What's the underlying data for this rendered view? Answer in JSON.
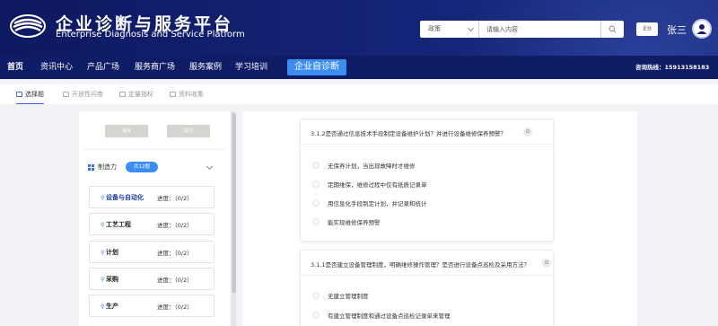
{
  "header": {
    "title": "企业诊断与服务平台",
    "subtitle": "Enterprise Diagnosis and Service Platform",
    "search_select_value": "政策",
    "search_placeholder": "请输入内容",
    "corp_button": "企业",
    "user_name": "张三",
    "brand_color": "#142476"
  },
  "nav": {
    "items": [
      "首页",
      "资讯中心",
      "产品广场",
      "服务商广场",
      "服务案例",
      "学习培训",
      "企业自诊断"
    ],
    "hotline": "咨询热线：15913158183",
    "active_color": "#3d8df0"
  },
  "tabs": [
    "选择题",
    "开放性问卷",
    "定量指标",
    "资料收集"
  ],
  "left": {
    "buttons": [
      "保存",
      "提交"
    ],
    "category": {
      "label": "制造力",
      "badge": "共12题"
    },
    "items": [
      {
        "name": "设备与自动化",
        "progress": "进度：（0/2）"
      },
      {
        "name": "工艺工程",
        "progress": "进度：（0/2）"
      },
      {
        "name": "计划",
        "progress": "进度：（0/2）"
      },
      {
        "name": "采购",
        "progress": "进度：（0/2）"
      },
      {
        "name": "生产",
        "progress": "进度：（0/2）"
      }
    ]
  },
  "questions": [
    {
      "title": "3.1.2是否通过信息技术手段制定设备维护计划？并进行设备维修保养预警？",
      "options": [
        "无保养计划，当出现故障时才维修",
        "定期维保，维修过程中仅有纸质记录单",
        "用信息化手段制定计划，并记录和统计",
        "能实现维修保养预警"
      ]
    },
    {
      "title": "3.1.1是否建立设备管理制度，明确维修操作管理？是否进行设备点巡检及采用方法？",
      "options": [
        "无建立管理制度",
        "有建立管理制度和通过设备点巡检记录单来管理"
      ]
    }
  ]
}
